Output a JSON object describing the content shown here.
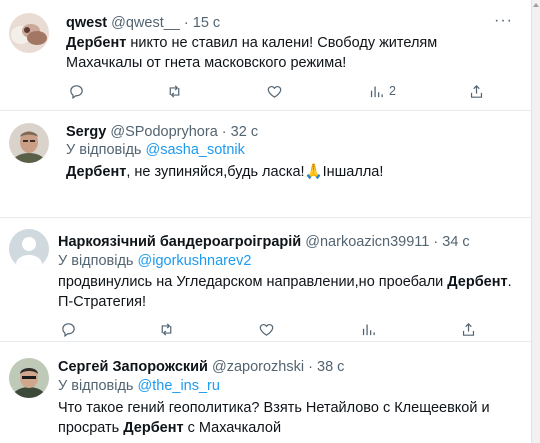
{
  "tweets": [
    {
      "name": "qwest",
      "handle": "@qwest__",
      "time": "15 с",
      "text_bold": "Дербент",
      "text_rest": " никто не ставил на калени! Свободу жителям Махачкалы от гнета масковского режима!",
      "views": "2"
    },
    {
      "name": "Sergy",
      "handle": "@SPodopryhora",
      "time": "32 с",
      "reply_prefix": "У відповідь",
      "reply_to": "@sasha_sotnik",
      "text_bold": "Дербент",
      "text_rest": ", не зупиняйся,будь ласка!🙏Іншалла!"
    },
    {
      "name": "Наркоязічний бандероагроіграрій",
      "handle": "@narkoazicn39911",
      "time": "34 с",
      "reply_prefix": "У відповідь",
      "reply_to": "@igorkushnarev2",
      "text_before": "продвинулись на Угледарском направлении,но проебали ",
      "text_bold": "Дербент",
      "text_after": ".",
      "text_line2": "П-Стратегия!"
    },
    {
      "name": "Сергей Запорожский",
      "handle": "@zaporozhski",
      "time": "38 с",
      "reply_prefix": "У відповідь",
      "reply_to": "@the_ins_ru",
      "text_line1": "Что такое гений геополитика? Взять Нетайлово с Клещеевкой и",
      "text_pre2": "просрать ",
      "text_bold": "Дербент",
      "text_after2": " с Махачкалой"
    }
  ],
  "separator": "·",
  "more": "···"
}
